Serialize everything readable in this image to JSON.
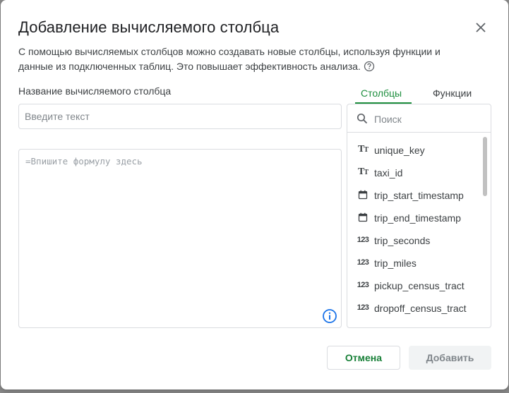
{
  "dialog": {
    "title": "Добавление вычисляемого столбца",
    "description": "С помощью вычисляемых столбцов можно создавать новые столбцы, используя функции и данные из подключенных таблиц. Это повышает эффективность анализа.",
    "name_label": "Название вычисляемого столбца",
    "name_input": {
      "value": "",
      "placeholder": "Введите текст"
    },
    "formula_input": {
      "value": "",
      "placeholder": "=Впишите формулу здесь"
    },
    "close_icon": "close-icon",
    "help_icon": "help-circle-icon",
    "info_icon": "info-icon"
  },
  "tabs": [
    {
      "label": "Столбцы",
      "active": true
    },
    {
      "label": "Функции",
      "active": false
    }
  ],
  "search": {
    "placeholder": "Поиск",
    "value": "",
    "icon": "search-icon"
  },
  "columns": [
    {
      "name": "unique_key",
      "type_icon": "text-type-icon"
    },
    {
      "name": "taxi_id",
      "type_icon": "text-type-icon"
    },
    {
      "name": "trip_start_timestamp",
      "type_icon": "calendar-icon"
    },
    {
      "name": "trip_end_timestamp",
      "type_icon": "calendar-icon"
    },
    {
      "name": "trip_seconds",
      "type_icon": "number-type-icon"
    },
    {
      "name": "trip_miles",
      "type_icon": "number-type-icon"
    },
    {
      "name": "pickup_census_tract",
      "type_icon": "number-type-icon"
    },
    {
      "name": "dropoff_census_tract",
      "type_icon": "number-type-icon"
    }
  ],
  "buttons": {
    "cancel": "Отмена",
    "add": "Добавить"
  },
  "colors": {
    "accent": "#1e8e3e",
    "disabled_bg": "#f1f3f4",
    "border": "#dadce0"
  }
}
